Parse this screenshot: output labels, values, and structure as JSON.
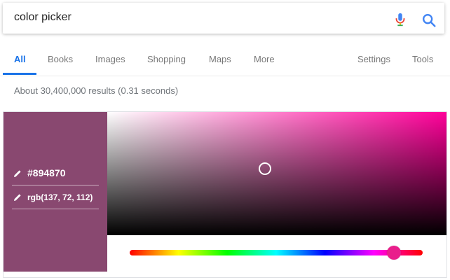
{
  "search": {
    "query": "color picker",
    "mic_icon": "microphone-icon",
    "search_icon": "magnifier-icon",
    "accent_color": "#4285f4"
  },
  "tabs": {
    "items": [
      {
        "label": "All",
        "active": true
      },
      {
        "label": "Books"
      },
      {
        "label": "Images"
      },
      {
        "label": "Shopping"
      },
      {
        "label": "Maps"
      },
      {
        "label": "More"
      },
      {
        "label": "Settings"
      },
      {
        "label": "Tools"
      }
    ],
    "active_color": "#1a73e8"
  },
  "results": {
    "stats": "About 30,400,000 results (0.31 seconds)"
  },
  "color_picker": {
    "hex": "#894870",
    "rgb": "rgb(137, 72, 112)",
    "swatch_color": "#894870",
    "hue_color": "#ff0099",
    "hue_handle_color": "#e91e8c",
    "edit_icon": "pencil-icon"
  }
}
